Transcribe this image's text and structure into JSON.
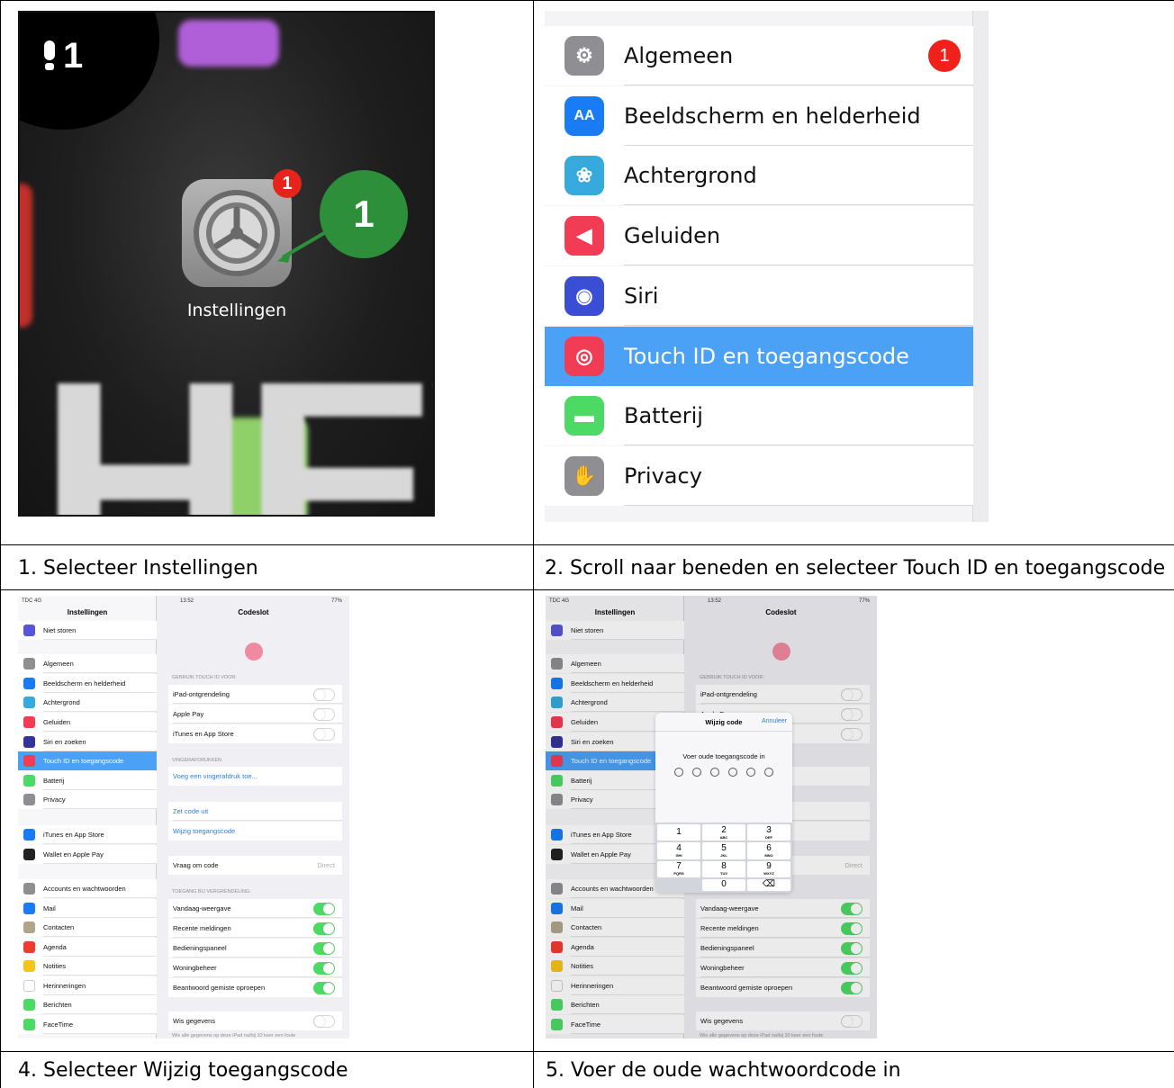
{
  "captions": {
    "c1": "1. Selecteer Instellingen",
    "c2": "2. Scroll naar beneden en selecteer Touch ID en toegangscode",
    "c4": "4. Selecteer Wijzig toegangscode",
    "c5": "5. Voer de oude wachtwoordcode in"
  },
  "home": {
    "step_number": "1",
    "app_label": "Instellingen",
    "app_badge": "1",
    "callout": "1",
    "background_letters": "HEY"
  },
  "settings_list": {
    "items": [
      {
        "label": "Algemeen",
        "icon": "gear-icon",
        "color": "#8e8e93",
        "badge": "1"
      },
      {
        "label": "Beeldscherm en helderheid",
        "icon": "text-size-icon",
        "color": "#1a7cf5"
      },
      {
        "label": "Achtergrond",
        "icon": "flower-icon",
        "color": "#36aadc"
      },
      {
        "label": "Geluiden",
        "icon": "speaker-icon",
        "color": "#f23b55"
      },
      {
        "label": "Siri",
        "icon": "siri-icon",
        "color": "#3a4ed5"
      },
      {
        "label": "Touch ID en toegangscode",
        "icon": "fingerprint-icon",
        "color": "#f23b55",
        "selected": true
      },
      {
        "label": "Batterij",
        "icon": "battery-icon",
        "color": "#4cd964"
      },
      {
        "label": "Privacy",
        "icon": "hand-icon",
        "color": "#8e8e93"
      }
    ]
  },
  "ipad": {
    "status_left": "TDC 4G",
    "status_time": "13:52",
    "status_right": "77%",
    "sidebar_title": "Instellingen",
    "sidebar": [
      {
        "label": "Niet storen",
        "color": "#5856d6"
      },
      {
        "label": "Algemeen",
        "color": "#8e8e93"
      },
      {
        "label": "Beeldscherm en helderheid",
        "color": "#1a7cf5"
      },
      {
        "label": "Achtergrond",
        "color": "#36aadc"
      },
      {
        "label": "Geluiden",
        "color": "#f23b55"
      },
      {
        "label": "Siri en zoeken",
        "color": "#333399"
      },
      {
        "label": "Touch ID en toegangscode",
        "color": "#f23b55",
        "selected": true
      },
      {
        "label": "Batterij",
        "color": "#4cd964"
      },
      {
        "label": "Privacy",
        "color": "#8e8e93"
      },
      {
        "label": "iTunes en App Store",
        "color": "#1a7cf5"
      },
      {
        "label": "Wallet en Apple Pay",
        "color": "#222222"
      },
      {
        "label": "Accounts en wachtwoorden",
        "color": "#8e8e93"
      },
      {
        "label": "Mail",
        "color": "#1a7cf5"
      },
      {
        "label": "Contacten",
        "color": "#b0a48a"
      },
      {
        "label": "Agenda",
        "color": "#f23b30"
      },
      {
        "label": "Notities",
        "color": "#f5c518"
      },
      {
        "label": "Herinneringen",
        "color": "#ffffff"
      },
      {
        "label": "Berichten",
        "color": "#4cd964"
      },
      {
        "label": "FaceTime",
        "color": "#4cd964"
      }
    ],
    "detail_title": "Codeslot",
    "touch_header": "GEBRUIK TOUCH ID VOOR:",
    "touch_rows": [
      "iPad-ontgrendeling",
      "Apple Pay",
      "iTunes en App Store"
    ],
    "finger_header": "VINGERAFDRUKKEN",
    "add_finger": "Voeg een vingerafdruk toe...",
    "code_off": "Zet code uit",
    "change_code": "Wijzig toegangscode",
    "ask_code": "Vraag om code",
    "ask_code_value": "Direct",
    "lock_header": "TOEGANG BIJ VERGRENDELING:",
    "lock_rows": [
      "Vandaag-weergave",
      "Recente meldingen",
      "Bedieningspaneel",
      "Woningbeheer",
      "Beantwoord gemiste oproepen"
    ],
    "erase": "Wis gegevens",
    "erase_note": "Wis alle gegevens op deze iPad na/bij 10 keer een foute"
  },
  "modal": {
    "title": "Wijzig code",
    "cancel": "Annuleer",
    "prompt": "Voer oude toegangscode in",
    "keys": [
      {
        "n": "1",
        "s": ""
      },
      {
        "n": "2",
        "s": "ABC"
      },
      {
        "n": "3",
        "s": "DEF"
      },
      {
        "n": "4",
        "s": "GHI"
      },
      {
        "n": "5",
        "s": "JKL"
      },
      {
        "n": "6",
        "s": "MNO"
      },
      {
        "n": "7",
        "s": "PQRS"
      },
      {
        "n": "8",
        "s": "TUV"
      },
      {
        "n": "9",
        "s": "WXYZ"
      },
      {
        "n": "",
        "s": ""
      },
      {
        "n": "0",
        "s": ""
      },
      {
        "n": "⌫",
        "s": ""
      }
    ]
  }
}
